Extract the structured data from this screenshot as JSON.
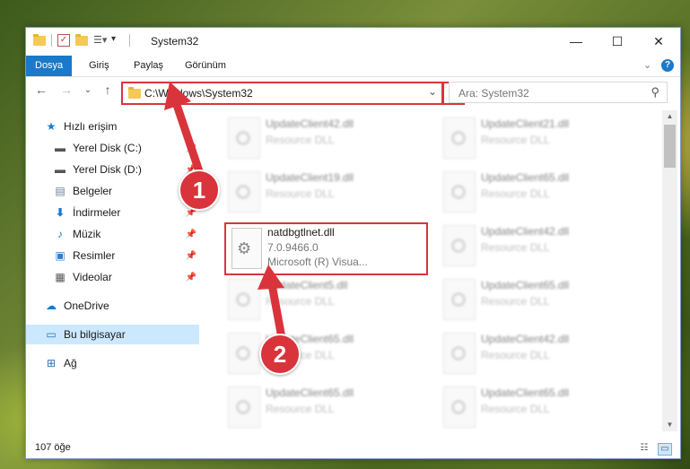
{
  "window": {
    "title": "System32"
  },
  "ribbon": {
    "tabs": [
      "Dosya",
      "Giriş",
      "Paylaş",
      "Görünüm"
    ]
  },
  "address": {
    "path": "C:\\Windows\\System32"
  },
  "search": {
    "placeholder": "Ara: System32"
  },
  "nav": {
    "items": [
      {
        "label": "Hızlı erişim",
        "icon": "star-icon"
      },
      {
        "label": "Yerel Disk (C:)",
        "icon": "drive-icon"
      },
      {
        "label": "Yerel Disk (D:)",
        "icon": "drive-icon"
      },
      {
        "label": "Belgeler",
        "icon": "documents-icon"
      },
      {
        "label": "İndirmeler",
        "icon": "download-icon"
      },
      {
        "label": "Müzik",
        "icon": "music-icon"
      },
      {
        "label": "Resimler",
        "icon": "pictures-icon"
      },
      {
        "label": "Videolar",
        "icon": "video-icon"
      },
      {
        "label": "OneDrive",
        "icon": "cloud-icon"
      },
      {
        "label": "Bu bilgisayar",
        "icon": "computer-icon"
      },
      {
        "label": "Ağ",
        "icon": "network-icon"
      }
    ]
  },
  "files": [
    {
      "name": "UpdateClient42.dll",
      "type": "Resource DLL"
    },
    {
      "name": "UpdateClient21.dll",
      "type": "Resource DLL"
    },
    {
      "name": "UpdateClient19.dll",
      "type": "Resource DLL"
    },
    {
      "name": "UpdateClient65.dll",
      "type": "Resource DLL"
    },
    {
      "name": "UpdateClient42.dll",
      "type": "Resource DLL"
    },
    {
      "name": "UpdateClient5.dll",
      "type": "Resource DLL"
    },
    {
      "name": "UpdateClient65.dll",
      "type": "Resource DLL"
    },
    {
      "name": "UpdateClient65.dll",
      "type": "Resource DLL"
    },
    {
      "name": "UpdateClient42.dll",
      "type": "Resource DLL"
    },
    {
      "name": "UpdateClient65.dll",
      "type": "Resource DLL"
    },
    {
      "name": "UpdateClient65.dll",
      "type": "Resource DLL"
    }
  ],
  "highlighted_file": {
    "name": "natdbgtlnet.dll",
    "version": "7.0.9466.0",
    "company": "Microsoft (R) Visua..."
  },
  "status": {
    "count": "107 öğe"
  },
  "annotations": {
    "badge1": "1",
    "badge2": "2"
  },
  "colors": {
    "accent": "#1979ca",
    "highlight": "#d9343b"
  }
}
